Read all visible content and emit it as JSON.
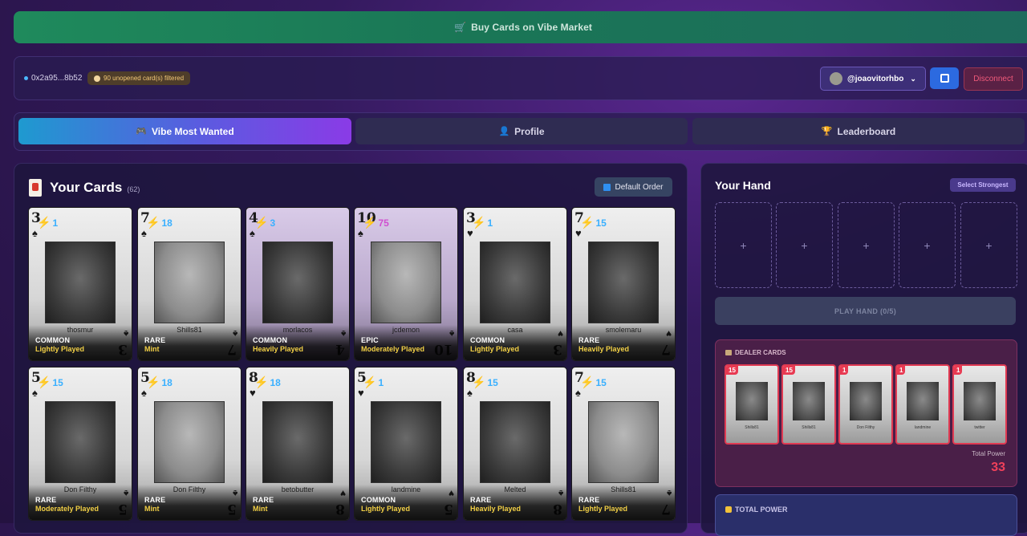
{
  "market": {
    "label": "Buy Cards on Vibe Market",
    "icon": "cart-icon"
  },
  "wallet": {
    "address": "0x2a95...8b52",
    "unopened_badge": "90 unopened card(s) filtered",
    "username": "@joaovitorhbo",
    "disconnect_label": "Disconnect"
  },
  "tabs": [
    {
      "label": "Vibe Most Wanted",
      "icon": "gamepad-icon",
      "active": true
    },
    {
      "label": "Profile",
      "icon": "user-icon",
      "active": false
    },
    {
      "label": "Leaderboard",
      "icon": "trophy-icon",
      "active": false
    }
  ],
  "cards_panel": {
    "title": "Your Cards",
    "count": "(62)",
    "order_label": "Default Order"
  },
  "cards": [
    {
      "rank": "3",
      "suit": "♠",
      "power": "1",
      "name": "thosmur",
      "rarity": "COMMON",
      "condition": "Lightly Played"
    },
    {
      "rank": "7",
      "suit": "♠",
      "power": "18",
      "name": "Shills81",
      "rarity": "RARE",
      "condition": "Mint"
    },
    {
      "rank": "4",
      "suit": "♠",
      "power": "3",
      "name": "morlacos",
      "rarity": "COMMON",
      "condition": "Heavily Played"
    },
    {
      "rank": "10",
      "suit": "♠",
      "power": "75",
      "name": "jcdemon",
      "rarity": "EPIC",
      "condition": "Moderately Played"
    },
    {
      "rank": "3",
      "suit": "♥",
      "power": "1",
      "name": "casa",
      "rarity": "COMMON",
      "condition": "Lightly Played"
    },
    {
      "rank": "7",
      "suit": "♥",
      "power": "15",
      "name": "smolemaru",
      "rarity": "RARE",
      "condition": "Heavily Played"
    },
    {
      "rank": "5",
      "suit": "♠",
      "power": "15",
      "name": "Don Filthy",
      "rarity": "RARE",
      "condition": "Moderately Played"
    },
    {
      "rank": "5",
      "suit": "♠",
      "power": "18",
      "name": "Don Filthy",
      "rarity": "RARE",
      "condition": "Mint"
    },
    {
      "rank": "8",
      "suit": "♥",
      "power": "18",
      "name": "betobutter",
      "rarity": "RARE",
      "condition": "Mint"
    },
    {
      "rank": "5",
      "suit": "♥",
      "power": "1",
      "name": "landmine",
      "rarity": "COMMON",
      "condition": "Lightly Played"
    },
    {
      "rank": "8",
      "suit": "♠",
      "power": "15",
      "name": "Melted",
      "rarity": "RARE",
      "condition": "Heavily Played"
    },
    {
      "rank": "7",
      "suit": "♠",
      "power": "15",
      "name": "Shills81",
      "rarity": "RARE",
      "condition": "Lightly Played"
    }
  ],
  "hand": {
    "title": "Your Hand",
    "select_label": "Select Strongest",
    "slot_symbol": "+",
    "play_label": "PLAY HAND (0/5)"
  },
  "dealer": {
    "title": "DEALER CARDS",
    "cards": [
      {
        "power": "15",
        "name": "Shills81"
      },
      {
        "power": "15",
        "name": "Shills81"
      },
      {
        "power": "1",
        "name": "Don Filthy"
      },
      {
        "power": "1",
        "name": "landmine"
      },
      {
        "power": "1",
        "name": "twitter"
      }
    ],
    "total_label": "Total Power",
    "total_value": "33"
  },
  "total_power": {
    "label": "TOTAL POWER"
  }
}
